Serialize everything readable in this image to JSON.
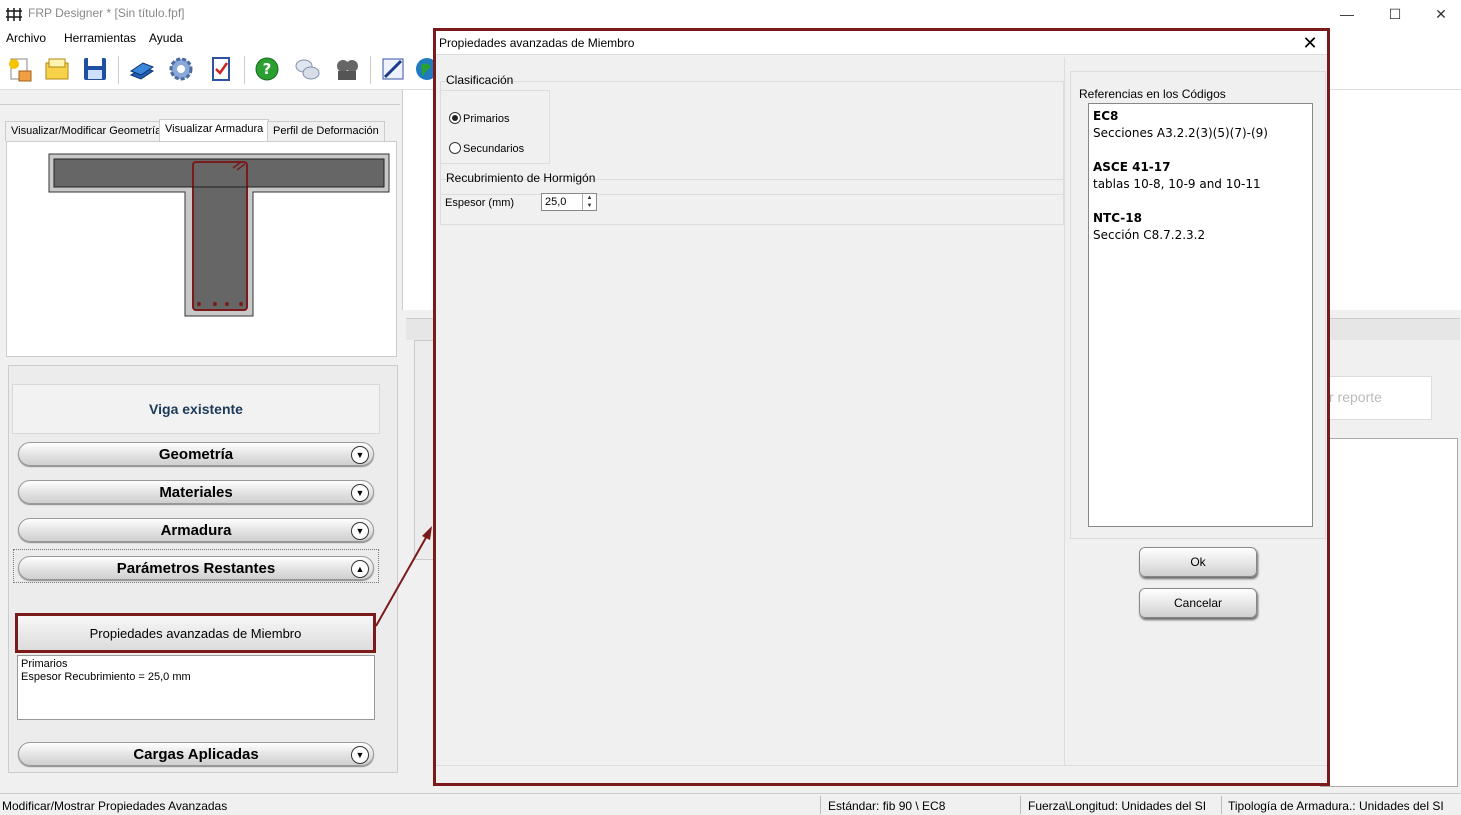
{
  "window": {
    "title": "FRP Designer * [Sin título.fpf]",
    "controls": [
      "minimize-icon",
      "maximize-icon",
      "close-icon"
    ]
  },
  "menu": [
    "Archivo",
    "Herramientas",
    "Ayuda"
  ],
  "toolbar": {
    "buttons": [
      "new-file-icon",
      "open-folder-icon",
      "save-icon",
      "book-icon",
      "settings-gear-icon",
      "checklist-icon",
      "help-icon",
      "chat-icon",
      "film-icon",
      "edit-icon",
      "globe-icon"
    ]
  },
  "tabs": [
    "Visualizar/Modificar Geometría",
    "Visualizar Armadura",
    "Perfil de Deformación"
  ],
  "active_tab": "Visualizar Armadura",
  "left": {
    "header": "Viga existente",
    "sections": [
      "Geometría",
      "Materiales",
      "Armadura",
      "Parámetros Restantes",
      "Cargas Aplicadas"
    ],
    "advanced_button": "Propiedades avanzadas de Miembro",
    "advanced_summary": [
      "Primarios",
      "Espesor Recubrimiento  = 25,0 mm"
    ]
  },
  "background": {
    "report_button": "r reporte"
  },
  "statusbar": {
    "message": "Modificar/Mostrar Propiedades Avanzadas",
    "standard": "Estándar: fib 90 \\ EC8",
    "units": "Fuerza\\Longitud: Unidades del SI",
    "typology": "Tipología de Armadura.: Unidades del SI"
  },
  "dialog": {
    "title": "Propiedades avanzadas de Miembro",
    "classification": {
      "label": "Clasificación",
      "options": [
        "Primarios",
        "Secundarios"
      ],
      "selected": "Primarios"
    },
    "cover": {
      "label": "Recubrimiento de Hormigón",
      "thickness_label": "Espesor (mm)",
      "thickness_value": "25,0"
    },
    "references": {
      "label": "Referencias en los Códigos",
      "items": [
        {
          "code": "EC8",
          "text": "Secciones A3.2.2(3)(5)(7)-(9)"
        },
        {
          "code": "ASCE 41-17",
          "text": "tablas 10-8, 10-9 and 10-11"
        },
        {
          "code": "NTC-18",
          "text": "Sección C8.7.2.3.2"
        }
      ]
    },
    "ok": "Ok",
    "cancel": "Cancelar"
  },
  "colors": {
    "highlight_border": "#7b1a1a",
    "header_text": "#1b3a5a"
  }
}
